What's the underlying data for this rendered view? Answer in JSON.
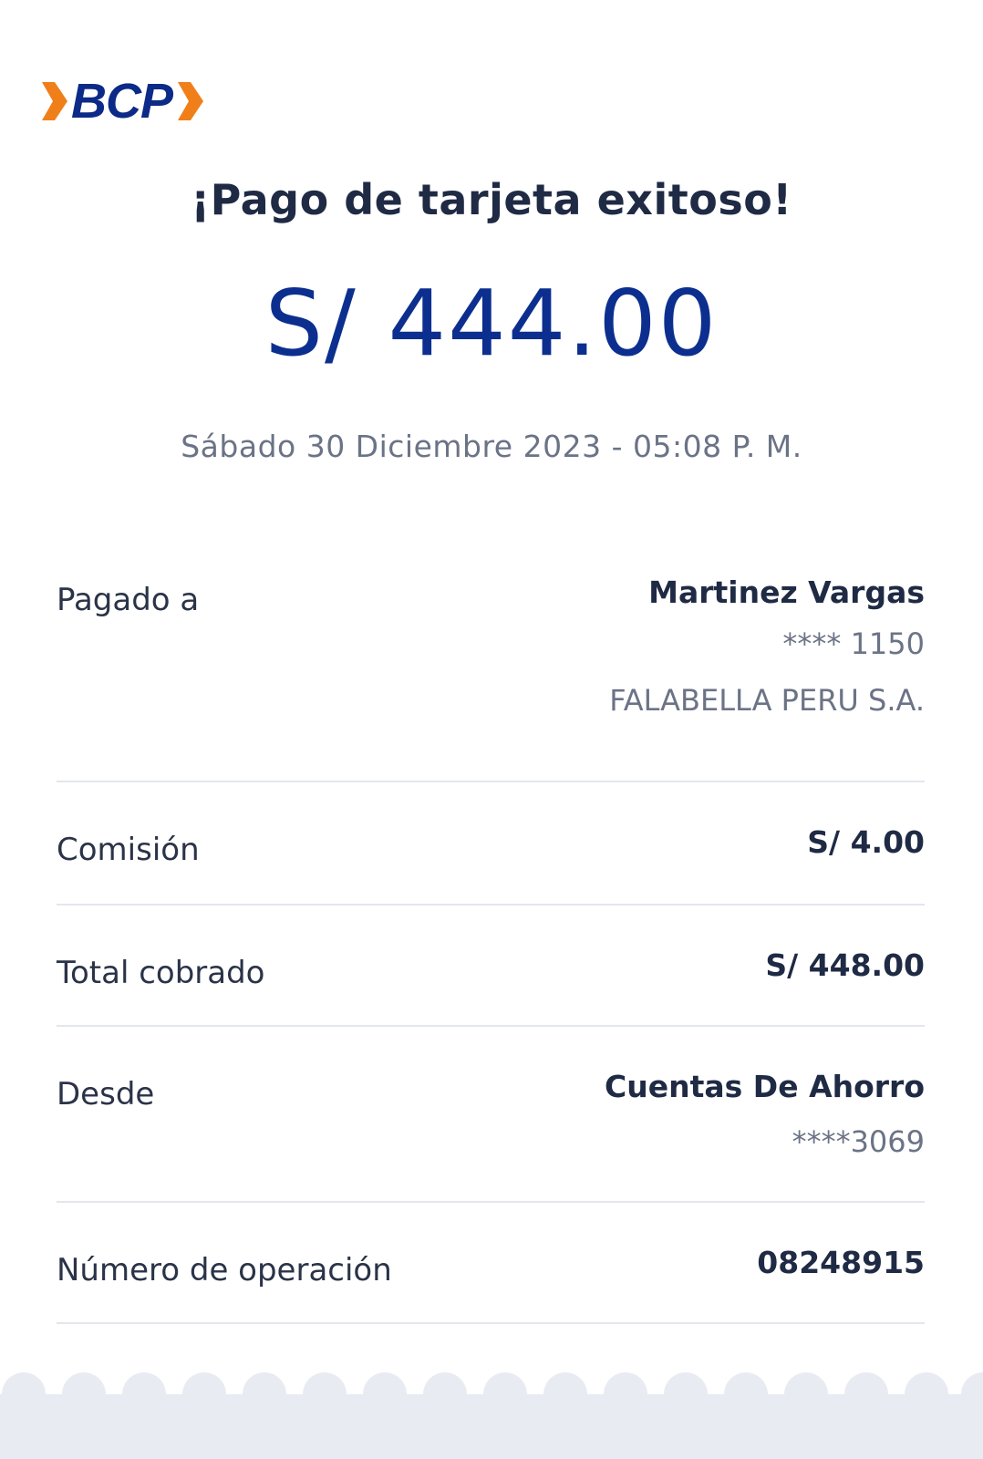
{
  "brand": {
    "logo_text": "BCP",
    "colors": {
      "blue": "#0c2a87",
      "orange": "#f07f1a"
    }
  },
  "receipt": {
    "title": "¡Pago de tarjeta exitoso!",
    "amount": "S/ 444.00",
    "datetime": "Sábado 30 Diciembre 2023 - 05:08 P. M."
  },
  "details": {
    "paid_to": {
      "label": "Pagado a",
      "name": "Martinez Vargas",
      "card": "**** 1150",
      "entity": "FALABELLA PERU S.A."
    },
    "commission": {
      "label": "Comisión",
      "value": "S/ 4.00"
    },
    "total": {
      "label": "Total cobrado",
      "value": "S/ 448.00"
    },
    "from": {
      "label": "Desde",
      "account": "Cuentas De Ahorro",
      "number": "****3069"
    },
    "operation": {
      "label": "Número de operación",
      "value": "08248915"
    }
  },
  "colors": {
    "accent_blue": "#0c2f8f",
    "text_dark": "#1f2a44",
    "text_muted": "#6b7386",
    "divider": "#e3e6ec",
    "footer_bg": "#e8ecf2"
  }
}
